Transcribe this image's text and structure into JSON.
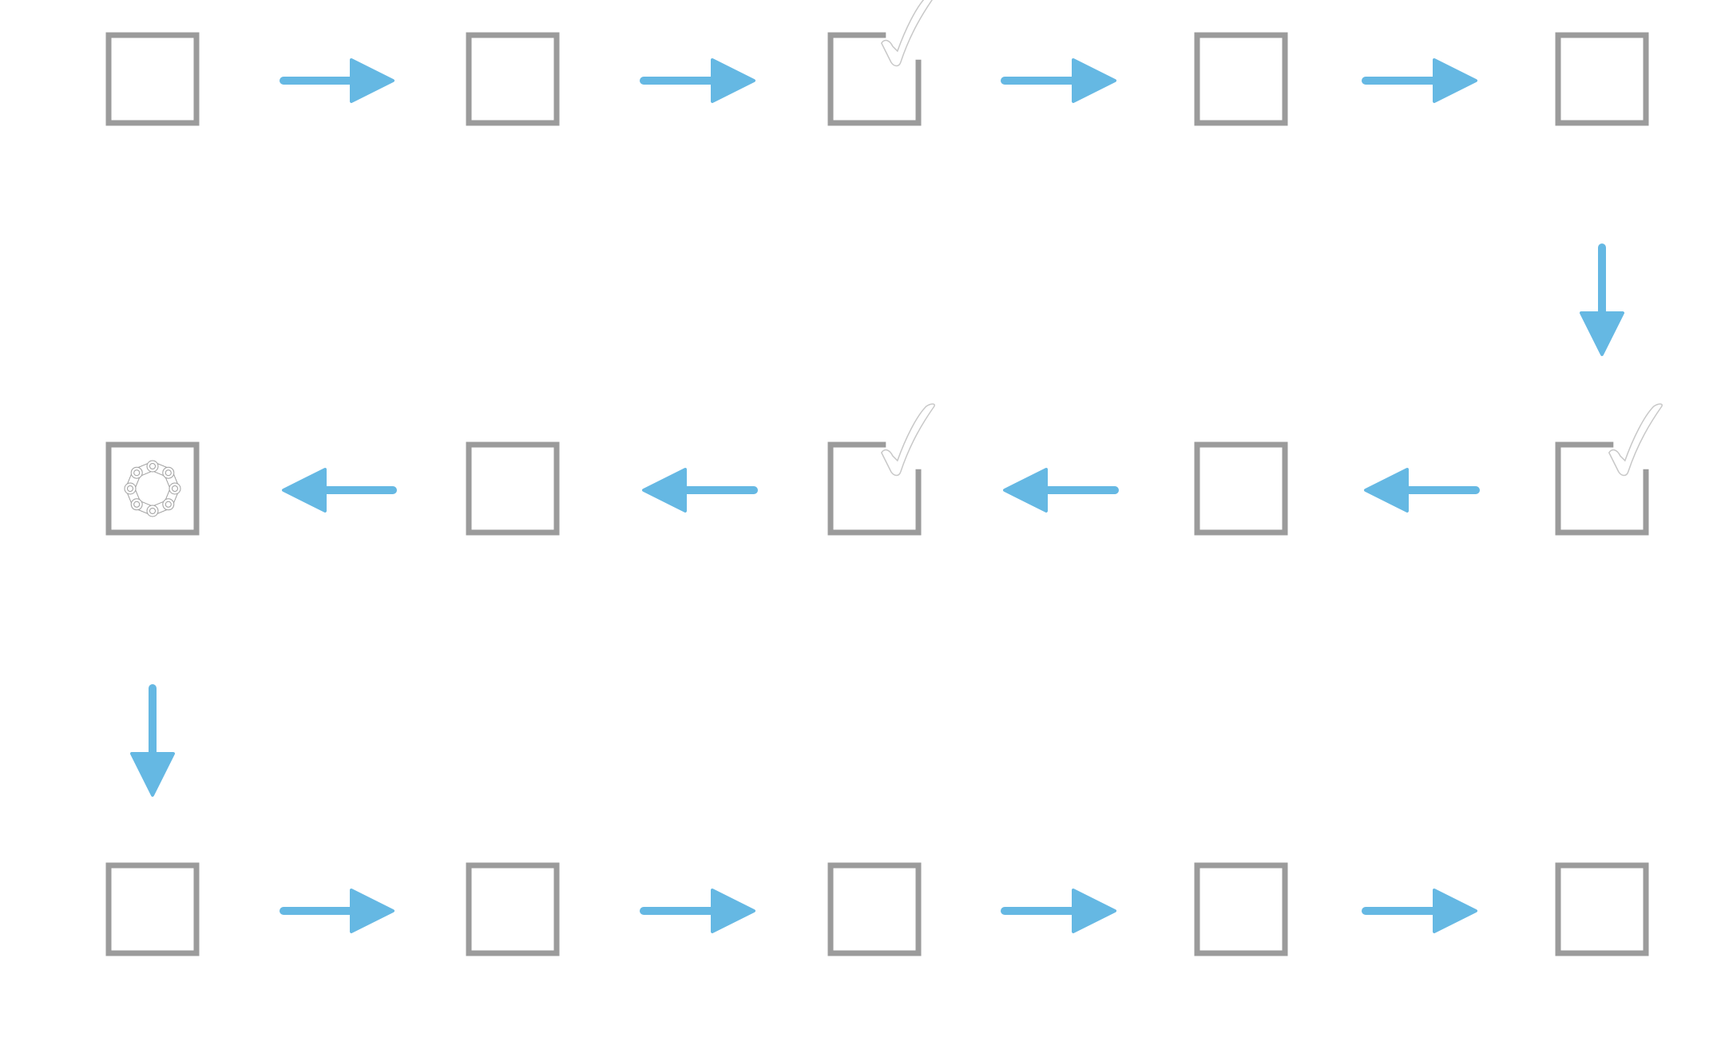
{
  "diagram": {
    "type": "serpentine-flow",
    "colors": {
      "box_stroke": "#9B9B9B",
      "arrow": "#65B8E3",
      "check_fill": "#FFFFFF",
      "check_outline": "#C8C8C8",
      "icon_outline": "#A0A0A0",
      "background": "#FFFFFF"
    },
    "rows": [
      {
        "direction": "left-to-right",
        "steps": [
          {
            "id": "r1s1",
            "state": "empty"
          },
          {
            "id": "r1s2",
            "state": "empty"
          },
          {
            "id": "r1s3",
            "state": "checked"
          },
          {
            "id": "r1s4",
            "state": "empty"
          },
          {
            "id": "r1s5",
            "state": "empty"
          }
        ]
      },
      {
        "direction": "right-to-left",
        "steps": [
          {
            "id": "r2s1",
            "state": "chain-icon"
          },
          {
            "id": "r2s2",
            "state": "empty"
          },
          {
            "id": "r2s3",
            "state": "checked"
          },
          {
            "id": "r2s4",
            "state": "empty"
          },
          {
            "id": "r2s5",
            "state": "checked"
          }
        ]
      },
      {
        "direction": "left-to-right",
        "steps": [
          {
            "id": "r3s1",
            "state": "empty"
          },
          {
            "id": "r3s2",
            "state": "empty"
          },
          {
            "id": "r3s3",
            "state": "empty"
          },
          {
            "id": "r3s4",
            "state": "empty"
          },
          {
            "id": "r3s5",
            "state": "empty"
          }
        ]
      }
    ],
    "connectors": [
      {
        "from_row": 0,
        "to_row": 1,
        "side": "right",
        "direction": "down"
      },
      {
        "from_row": 1,
        "to_row": 2,
        "side": "left",
        "direction": "down"
      }
    ]
  }
}
